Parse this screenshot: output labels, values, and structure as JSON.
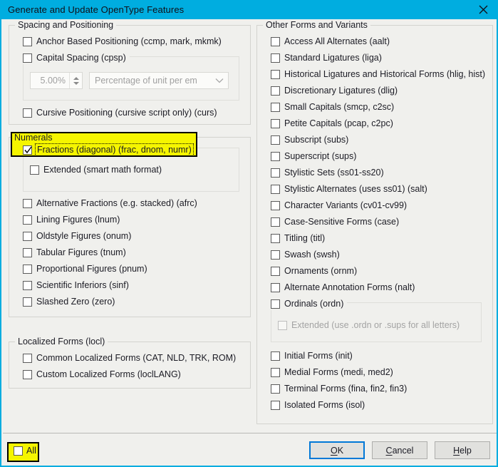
{
  "window": {
    "title": "Generate and Update OpenType Features",
    "titlebar_color": "#00ADE0",
    "close_icon": "close-icon"
  },
  "left_column": {
    "spacing_group": {
      "legend": "Spacing and Positioning",
      "items": [
        {
          "label": "Anchor Based Positioning (ccmp, mark, mkmk)",
          "checked": false,
          "disabled": false
        },
        {
          "label": "Capital Spacing (cpsp)",
          "checked": false,
          "disabled": false
        },
        {
          "label": "Cursive Positioning (cursive script only) (curs)",
          "checked": false,
          "disabled": false
        }
      ],
      "spinner": {
        "value": "5.00%",
        "disabled": true
      },
      "combo": {
        "value": "Percentage of unit per em",
        "disabled": true,
        "icon": "chevron-down-icon"
      }
    },
    "numerals_group": {
      "legend": "Numerals",
      "highlighted_item": {
        "label": "Fractions (diagonal) (frac, dnom, numr)",
        "checked": true,
        "focused": true
      },
      "sub_item": {
        "label": "Extended (smart math format)",
        "checked": false,
        "disabled": false
      },
      "items": [
        {
          "label": "Alternative Fractions (e.g. stacked) (afrc)",
          "checked": false
        },
        {
          "label": "Lining Figures (lnum)",
          "checked": false
        },
        {
          "label": "Oldstyle Figures (onum)",
          "checked": false
        },
        {
          "label": "Tabular Figures (tnum)",
          "checked": false
        },
        {
          "label": "Proportional Figures (pnum)",
          "checked": false
        },
        {
          "label": "Scientific Inferiors (sinf)",
          "checked": false
        },
        {
          "label": "Slashed Zero (zero)",
          "checked": false
        }
      ]
    },
    "localized_group": {
      "legend": "Localized Forms (locl)",
      "items": [
        {
          "label": "Common Localized Forms (CAT, NLD, TRK, ROM)",
          "checked": false
        },
        {
          "label": "Custom Localized Forms (loclLANG)",
          "checked": false
        }
      ]
    }
  },
  "right_column": {
    "other_group": {
      "legend": "Other Forms and Variants",
      "items": [
        {
          "label": "Access All Alternates (aalt)",
          "checked": false
        },
        {
          "label": "Standard Ligatures (liga)",
          "checked": false
        },
        {
          "label": "Historical Ligatures and Historical Forms (hlig, hist)",
          "checked": false
        },
        {
          "label": "Discretionary Ligatures (dlig)",
          "checked": false
        },
        {
          "label": "Small Capitals (smcp, c2sc)",
          "checked": false
        },
        {
          "label": "Petite Capitals (pcap, c2pc)",
          "checked": false
        },
        {
          "label": "Subscript (subs)",
          "checked": false
        },
        {
          "label": "Superscript (sups)",
          "checked": false
        },
        {
          "label": "Stylistic Sets (ss01-ss20)",
          "checked": false
        },
        {
          "label": "Stylistic Alternates (uses ss01) (salt)",
          "checked": false
        },
        {
          "label": "Character Variants (cv01-cv99)",
          "checked": false
        },
        {
          "label": "Case-Sensitive Forms (case)",
          "checked": false
        },
        {
          "label": "Titling (titl)",
          "checked": false
        },
        {
          "label": "Swash (swsh)",
          "checked": false
        },
        {
          "label": "Ornaments (ornm)",
          "checked": false
        },
        {
          "label": "Alternate Annotation Forms (nalt)",
          "checked": false
        }
      ],
      "ordinals": {
        "label": "Ordinals (ordn)",
        "checked": false
      },
      "ordinals_sub": {
        "label": "Extended (use .ordn or .sups for all letters)",
        "checked": false,
        "disabled": true
      },
      "forms": [
        {
          "label": "Initial Forms (init)",
          "checked": false
        },
        {
          "label": "Medial Forms (medi, med2)",
          "checked": false
        },
        {
          "label": "Terminal Forms (fina, fin2, fin3)",
          "checked": false
        },
        {
          "label": "Isolated Forms (isol)",
          "checked": false
        }
      ]
    }
  },
  "footer": {
    "all_checkbox": {
      "label": "All",
      "checked": false,
      "highlighted": true
    },
    "buttons": [
      {
        "label": "OK",
        "accel": "O",
        "rest": "K",
        "default": true
      },
      {
        "label": "Cancel",
        "accel": "C",
        "rest": "ancel",
        "default": false
      },
      {
        "label": "Help",
        "accel": "H",
        "rest": "elp",
        "default": false
      }
    ]
  },
  "annotations": {
    "highlight_color": "#f5f500",
    "highlight_border": "#000000"
  }
}
